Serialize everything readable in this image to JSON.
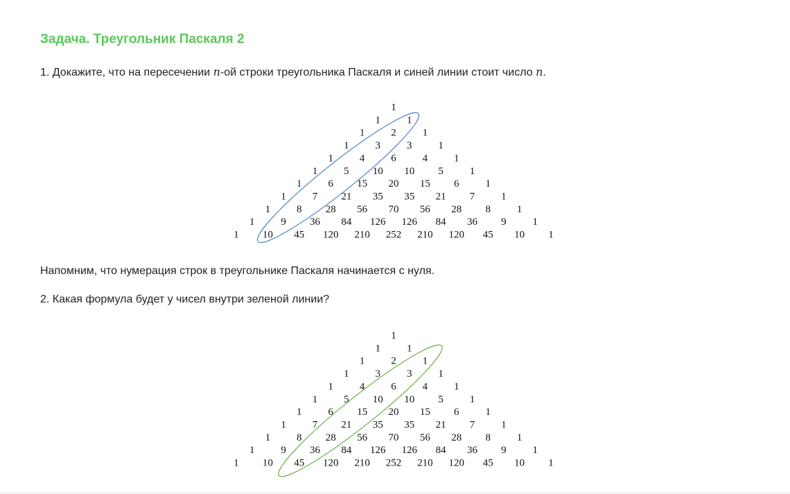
{
  "title": "Задача. Треугольник Паскаля 2",
  "question1": {
    "prefix": "1. Докажите, что на пересечении ",
    "var1": "n",
    "middle": "-ой строки треугольника Паскаля и синей линии стоит число ",
    "var2": "n",
    "suffix": "."
  },
  "note": "Напомним, что нумерация строк в треугольнике Паскаля начинается с нуля.",
  "question2": "2. Какая формула будет у чисел внутри зеленой линии?",
  "colors": {
    "title": "#5cc85c",
    "blue_line": "#4a86c8",
    "green_line": "#6ab04c"
  },
  "pascal_rows": [
    [
      "1"
    ],
    [
      "1",
      "1"
    ],
    [
      "1",
      "2",
      "1"
    ],
    [
      "1",
      "3",
      "3",
      "1"
    ],
    [
      "1",
      "4",
      "6",
      "4",
      "1"
    ],
    [
      "1",
      "5",
      "10",
      "10",
      "5",
      "1"
    ],
    [
      "1",
      "6",
      "15",
      "20",
      "15",
      "6",
      "1"
    ],
    [
      "1",
      "7",
      "21",
      "35",
      "35",
      "21",
      "7",
      "1"
    ],
    [
      "1",
      "8",
      "28",
      "56",
      "70",
      "56",
      "28",
      "8",
      "1"
    ],
    [
      "1",
      "9",
      "36",
      "84",
      "126",
      "126",
      "84",
      "36",
      "9",
      "1"
    ],
    [
      "1",
      "10",
      "45",
      "120",
      "210",
      "252",
      "210",
      "120",
      "45",
      "10",
      "1"
    ]
  ]
}
